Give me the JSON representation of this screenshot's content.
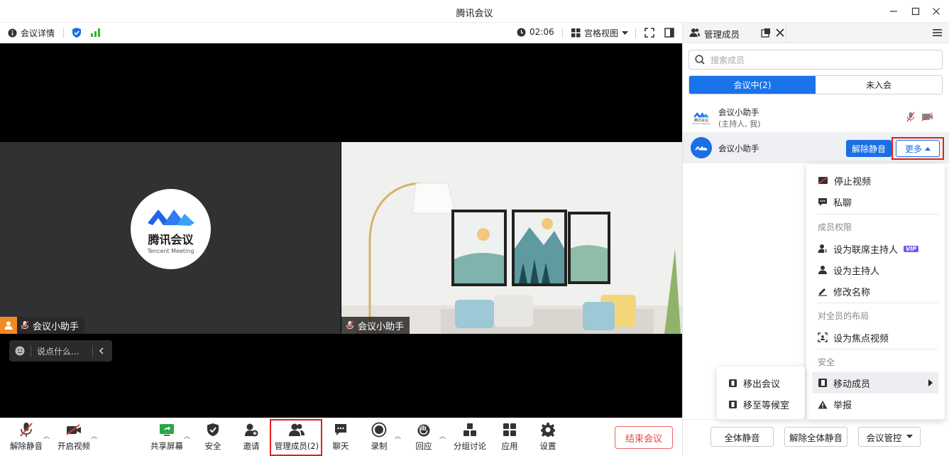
{
  "window": {
    "title": "腾讯会议"
  },
  "infobar": {
    "meeting_details": "会议详情",
    "timer": "02:06",
    "view_mode": "宫格视图"
  },
  "tiles": [
    {
      "name": "会议小助手",
      "logo_cn": "腾讯会议",
      "logo_en": "Tencent Meeting"
    },
    {
      "name": "会议小助手"
    }
  ],
  "chat": {
    "placeholder": "说点什么..."
  },
  "toolbar": {
    "unmute": "解除静音",
    "start_video": "开启视频",
    "share_screen": "共享屏幕",
    "security": "安全",
    "invite": "邀请",
    "manage_members": "管理成员(2)",
    "chat": "聊天",
    "record": "录制",
    "reactions": "回应",
    "breakout": "分组讨论",
    "apps": "应用",
    "settings": "设置",
    "end_meeting": "结束会议"
  },
  "panel": {
    "title": "管理成员",
    "search_placeholder": "搜索成员",
    "tabs": [
      "会议中(2)",
      "未入会"
    ],
    "members": [
      {
        "name": "会议小助手",
        "role": "(主持人, 我)",
        "logo_cn": "腾讯会议",
        "logo_en": "Tencent Meeting"
      },
      {
        "name": "会议小助手",
        "unmute_btn": "解除静音",
        "more_btn": "更多"
      }
    ],
    "footer": {
      "mute_all": "全体静音",
      "unmute_all": "解除全体静音",
      "meeting_control": "会议管控"
    }
  },
  "menu": {
    "stop_video": "停止视频",
    "private_chat": "私聊",
    "permission_header": "成员权限",
    "make_cohost": "设为联席主持人",
    "vip_badge": "VIP",
    "make_host": "设为主持人",
    "rename": "修改名称",
    "layout_header": "对全员的布局",
    "spotlight": "设为焦点视频",
    "security_header": "安全",
    "move_member": "移动成员",
    "report": "举报"
  },
  "submenu": {
    "remove": "移出会议",
    "waiting_room": "移至等候室"
  },
  "colors": {
    "accent": "#1a6fe3",
    "danger": "#e02020",
    "stage_bg": "#000000"
  }
}
